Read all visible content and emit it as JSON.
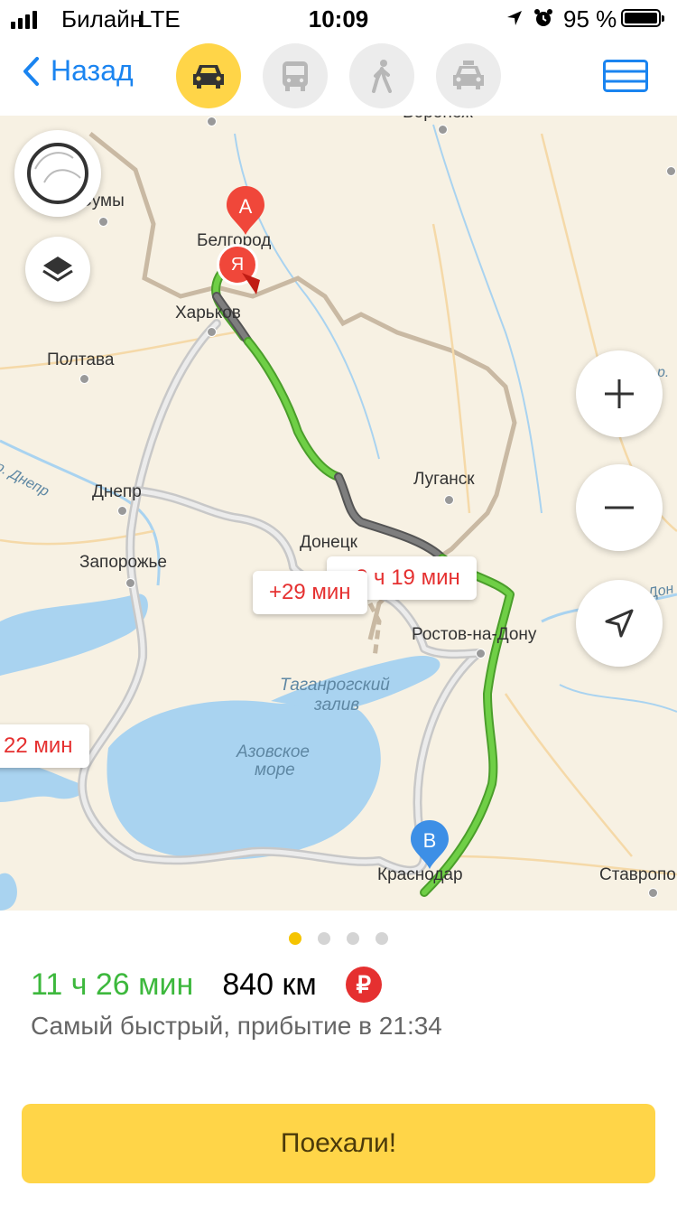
{
  "status": {
    "carrier": "Билайн",
    "network": "LTE",
    "time": "10:09",
    "battery": "95 %",
    "battery_level": 0.95
  },
  "nav": {
    "back_label": "Назад",
    "modes": [
      "car-icon",
      "bus-icon",
      "pedestrian-icon",
      "taxi-icon"
    ],
    "active_mode": "car-icon",
    "accent": "#1a84f0"
  },
  "map": {
    "cities": {
      "voronezh": "Воронеж",
      "sumy": "Сумы",
      "belgorod": "Белгород",
      "kharkov": "Харьков",
      "poltava": "Полтава",
      "dnepr": "Днепр",
      "lugansk": "Луганск",
      "zaporozhye": "Запорожье",
      "donetsk": "Донецк",
      "rostov": "Ростов-на-Дону",
      "krasnodar": "Краснодар",
      "stavropol": "Ставропо"
    },
    "water": {
      "taganrog": [
        "Таганрогский",
        "залив"
      ],
      "azov": [
        "Азовское",
        "море"
      ],
      "dnepr_river": "р. Днепр",
      "don_river": "р. Дон",
      "river_edge": "р."
    },
    "badges": {
      "alt1": "+2 ч 19 мин",
      "alt2": "+29 мин",
      "alt3": "22 мин"
    },
    "markers": {
      "start": "A",
      "me": "Я",
      "end": "B"
    },
    "colors": {
      "route_main": "#6fcf46",
      "route_slow": "#7e7e7e",
      "route_alt": "#c8c8c8",
      "marker_red": "#f0473a",
      "marker_blue": "#3d8fe6"
    }
  },
  "route": {
    "time": "11 ч 26 мин",
    "distance": "840 км",
    "toll_symbol": "₽",
    "subtitle": "Самый быстрый, прибытие в 21:34",
    "page_count": 4,
    "active_page": 1
  },
  "go_button": "Поехали!"
}
